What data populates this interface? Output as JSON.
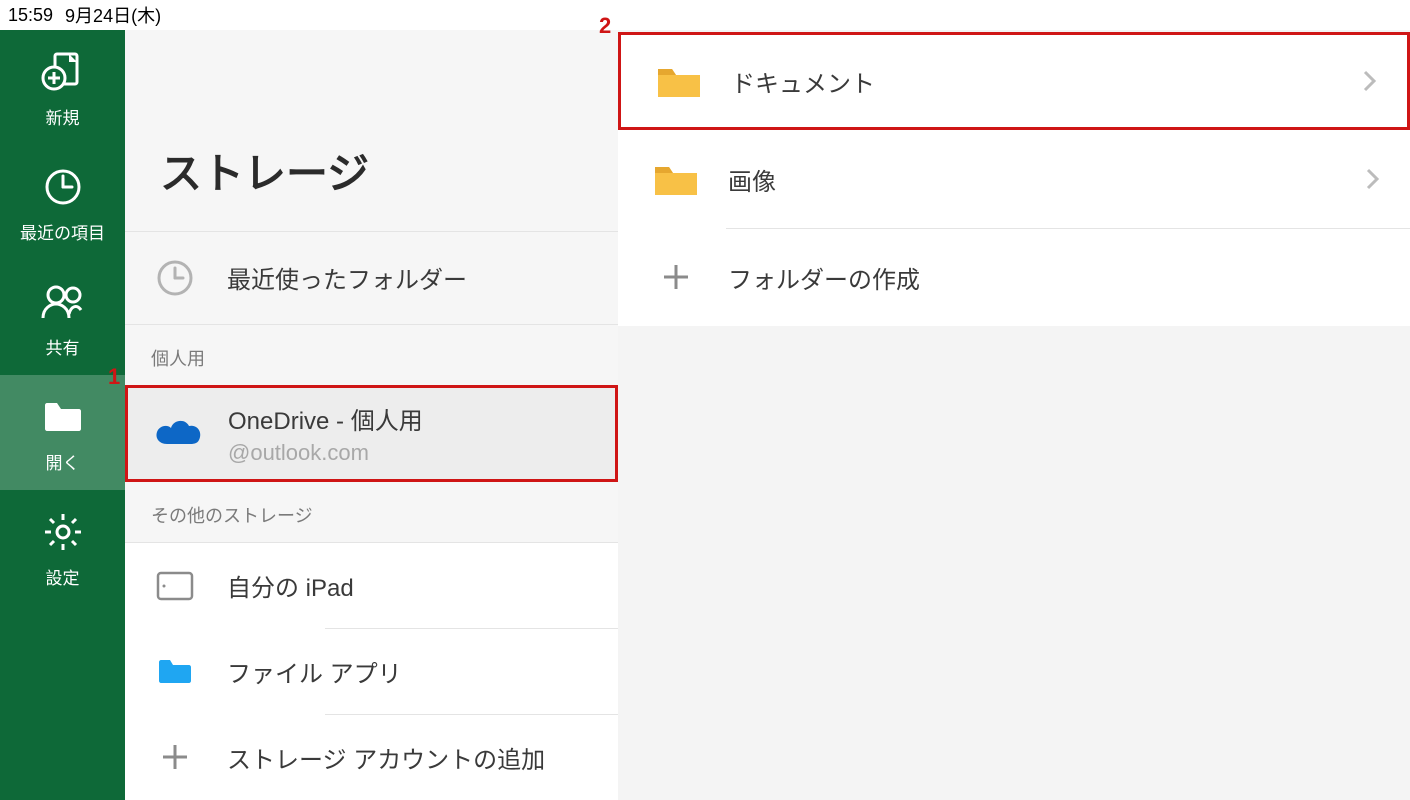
{
  "status_bar": {
    "time": "15:59",
    "date": "9月24日(木)"
  },
  "sidebar": {
    "items": [
      {
        "id": "new",
        "label": "新規",
        "icon": "new-doc-icon",
        "selected": false
      },
      {
        "id": "recent",
        "label": "最近の項目",
        "icon": "clock-icon",
        "selected": false
      },
      {
        "id": "shared",
        "label": "共有",
        "icon": "people-icon",
        "selected": false
      },
      {
        "id": "open",
        "label": "開く",
        "icon": "folder-open-icon",
        "selected": true
      },
      {
        "id": "settings",
        "label": "設定",
        "icon": "gear-icon",
        "selected": false
      }
    ]
  },
  "storage": {
    "title": "ストレージ",
    "recent_label": "最近使ったフォルダー",
    "sections": {
      "personal": {
        "label": "個人用",
        "account": {
          "title": "OneDrive - 個人用",
          "email_domain": "@outlook.com"
        }
      },
      "other": {
        "label": "その他のストレージ",
        "items": [
          {
            "id": "ipad",
            "label": "自分の iPad"
          },
          {
            "id": "files-app",
            "label": "ファイル アプリ"
          },
          {
            "id": "add-storage",
            "label": "ストレージ アカウントの追加"
          }
        ]
      }
    }
  },
  "detail": {
    "items": [
      {
        "id": "documents",
        "label": "ドキュメント",
        "highlight": true
      },
      {
        "id": "images",
        "label": "画像",
        "highlight": false
      },
      {
        "id": "create",
        "label": "フォルダーの作成",
        "highlight": false
      }
    ],
    "annotations": {
      "marker1": "1",
      "marker2": "2"
    }
  }
}
